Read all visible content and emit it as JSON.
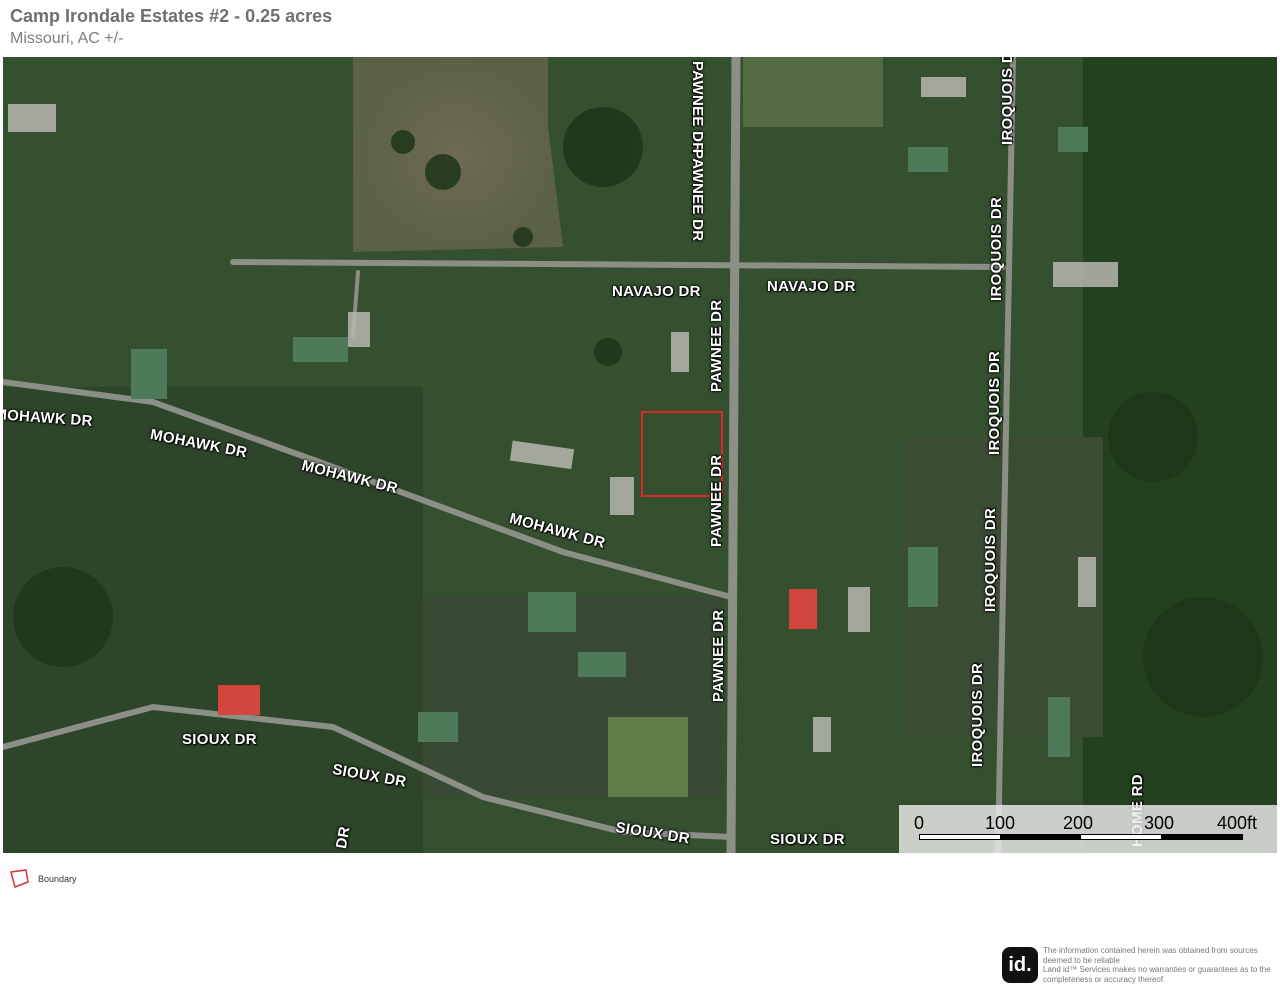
{
  "header": {
    "title": "Camp Irondale Estates #2 - 0.25 acres",
    "subtitle": "Missouri,  AC +/-"
  },
  "map": {
    "road_labels": {
      "pawnee_1": "PAWNEE DR",
      "pawnee_2": "PAWNEE DR",
      "pawnee_3": "PAWNEE DR",
      "pawnee_4": "PAWNEE DR",
      "pawnee_5": "DR",
      "navajo_1": "NAVAJO DR",
      "navajo_2": "NAVAJO DR",
      "iroquois_1": "IROQUOIS DR",
      "iroquois_2": "IROQUOIS DR",
      "iroquois_3": "IROQUOIS DR",
      "iroquois_4": "IROQUOIS DR",
      "iroquois_5": "IROQUOIS DR",
      "mohawk_1": "MOHAWK DR",
      "mohawk_2": "MOHAWK DR",
      "mohawk_3": "MOHAWK DR",
      "mohawk_4": "MOHAWK DR",
      "sioux_1": "SIOUX DR",
      "sioux_2": "SIOUX DR",
      "sioux_3": "SIOUX DR",
      "sioux_4": "SIOUX DR",
      "dr_partial": "DR",
      "home_rd": "HOME RD"
    },
    "boundary_color": "#e0252b",
    "scale": {
      "ticks": [
        "0",
        "100",
        "200",
        "300",
        "400ft"
      ]
    }
  },
  "legend": {
    "label": "Boundary",
    "icon": "boundary-polygon-icon"
  },
  "footer": {
    "logo_text": "id.",
    "disclaimer": [
      "The information contained herein was obtained from sources",
      "deemed to be reliable",
      " Land id™ Services makes no warranties or guarantees as to the",
      "completeness or accuracy thereof."
    ]
  }
}
